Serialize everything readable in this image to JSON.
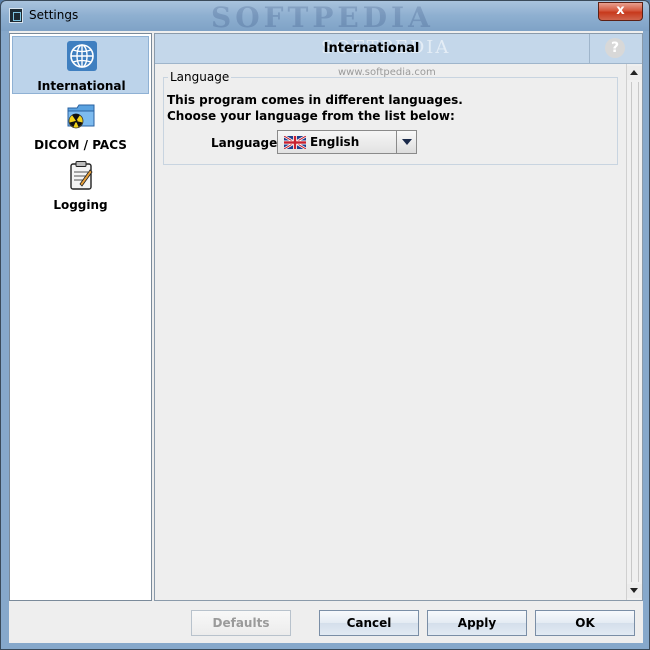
{
  "window": {
    "title": "Settings",
    "watermark": "SOFTPEDIA",
    "close_label": "x"
  },
  "sidebar": {
    "items": [
      {
        "label": "International",
        "icon": "globe-icon",
        "selected": true
      },
      {
        "label": "DICOM / PACS",
        "icon": "folder-radiation-icon",
        "selected": false
      },
      {
        "label": "Logging",
        "icon": "clipboard-icon",
        "selected": false
      }
    ]
  },
  "panel": {
    "title": "International",
    "header_watermark": "SOFTPEDIA",
    "help_label": "?",
    "watermark_url": "www.softpedia.com",
    "group": {
      "legend": "Language",
      "description_line1": "This program comes in different languages.",
      "description_line2": "Choose your language from the list below:",
      "field_label": "Language",
      "selected_language": "English",
      "flag_icon": "uk-flag-icon"
    }
  },
  "buttons": {
    "defaults": "Defaults",
    "cancel": "Cancel",
    "apply": "Apply",
    "ok": "OK"
  },
  "colors": {
    "selected_item_bg": "#bcd3ea",
    "header_bg": "#c4d7ea",
    "frame_blue": "#86a8cb"
  }
}
